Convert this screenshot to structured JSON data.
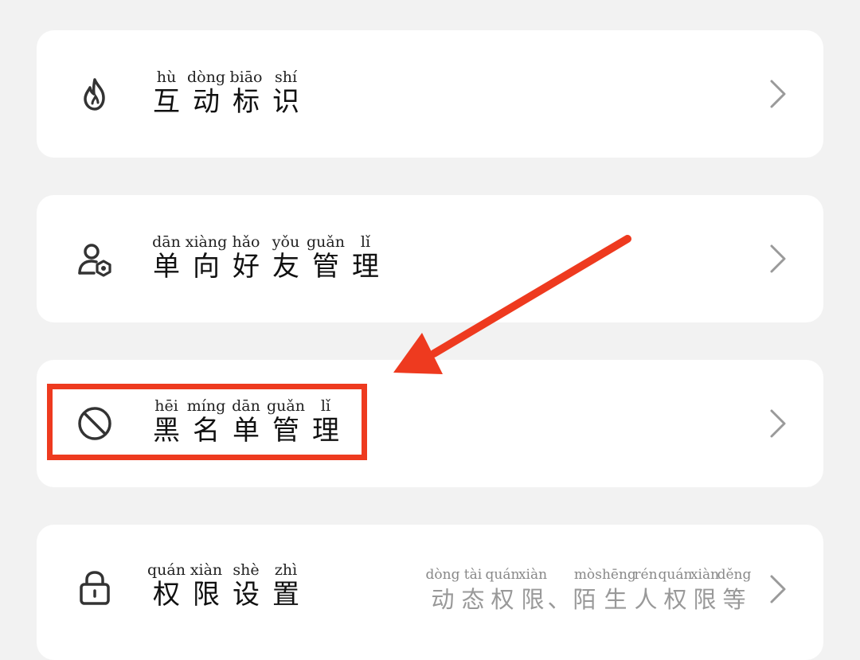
{
  "items": [
    {
      "icon": "flame-icon",
      "pinyin": [
        "hù",
        "dòng",
        "biāo",
        "shí"
      ],
      "chars": [
        "互",
        "动",
        "标",
        "识"
      ]
    },
    {
      "icon": "user-shield-icon",
      "pinyin": [
        "dān",
        "xiàng",
        "hǎo",
        "yǒu",
        "guǎn",
        "lǐ"
      ],
      "chars": [
        "单",
        "向",
        "好",
        "友",
        "管",
        "理"
      ]
    },
    {
      "icon": "block-icon",
      "pinyin": [
        "hēi",
        "míng",
        "dān",
        "guǎn",
        "lǐ"
      ],
      "chars": [
        "黑",
        "名",
        "单",
        "管",
        "理"
      ]
    },
    {
      "icon": "lock-icon",
      "pinyin": [
        "quán",
        "xiàn",
        "shè",
        "zhì"
      ],
      "chars": [
        "权",
        "限",
        "设",
        "置"
      ],
      "subtitle": {
        "pinyin": [
          "dòng",
          "tài",
          "quán",
          "xiàn",
          "",
          "mò",
          "shēng",
          "rén",
          "quán",
          "xiàn",
          "děng"
        ],
        "chars": [
          "动",
          "态",
          "权",
          "限",
          "、",
          "陌",
          "生",
          "人",
          "权",
          "限",
          "等"
        ]
      }
    }
  ],
  "colors": {
    "highlight": "#ee3a1f",
    "arrow": "#ee3a1f",
    "background": "#f2f2f2"
  }
}
